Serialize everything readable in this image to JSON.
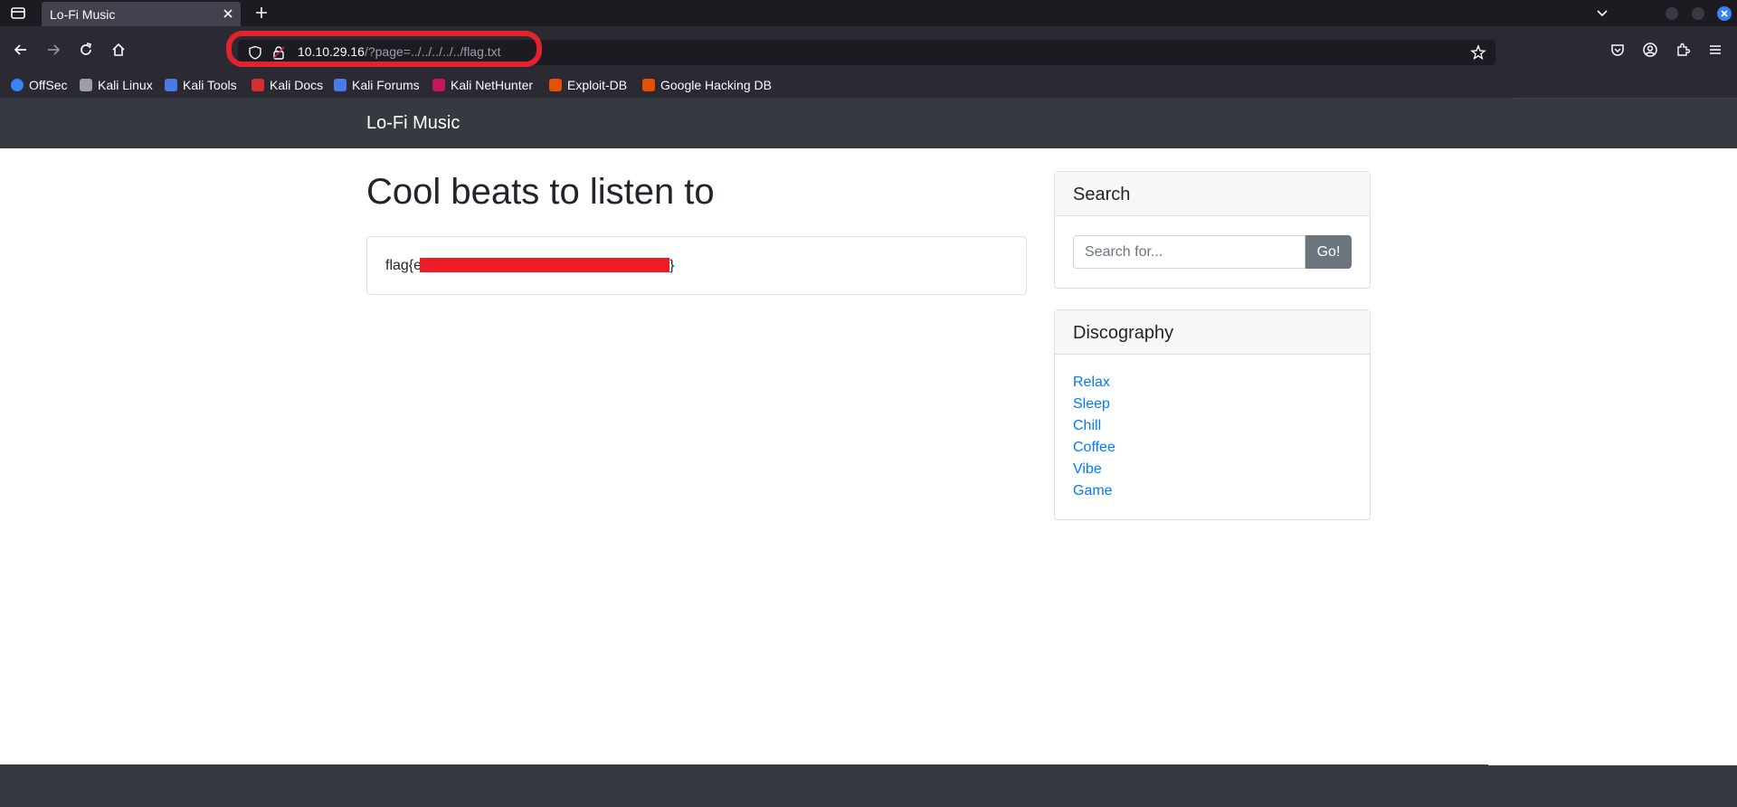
{
  "browser": {
    "tab_title": "Lo-Fi Music",
    "url_host": "10.10.29.16",
    "url_path": "/?page=../../../../../flag.txt",
    "bookmarks": [
      {
        "label": "OffSec",
        "color": "#3b82f6"
      },
      {
        "label": "Kali Linux",
        "color": "#9aa0a6"
      },
      {
        "label": "Kali Tools",
        "color": "#4a7ae8"
      },
      {
        "label": "Kali Docs",
        "color": "#d32f2f"
      },
      {
        "label": "Kali Forums",
        "color": "#4a7ae8"
      },
      {
        "label": "Kali NetHunter",
        "color": "#c2185b"
      },
      {
        "label": "Exploit-DB",
        "color": "#e65100"
      },
      {
        "label": "Google Hacking DB",
        "color": "#e65100"
      }
    ]
  },
  "site": {
    "brand": "Lo-Fi Music",
    "heading": "Cool beats to listen to",
    "flag_prefix": "flag{e",
    "flag_suffix": "}",
    "search": {
      "header": "Search",
      "placeholder": "Search for...",
      "button": "Go!"
    },
    "discography": {
      "header": "Discography",
      "items": [
        "Relax",
        "Sleep",
        "Chill",
        "Coffee",
        "Vibe",
        "Game"
      ]
    }
  },
  "colors": {
    "highlight": "#e2232e",
    "redaction": "#ed1c24",
    "link": "#007bff",
    "navbar": "#343a40"
  }
}
